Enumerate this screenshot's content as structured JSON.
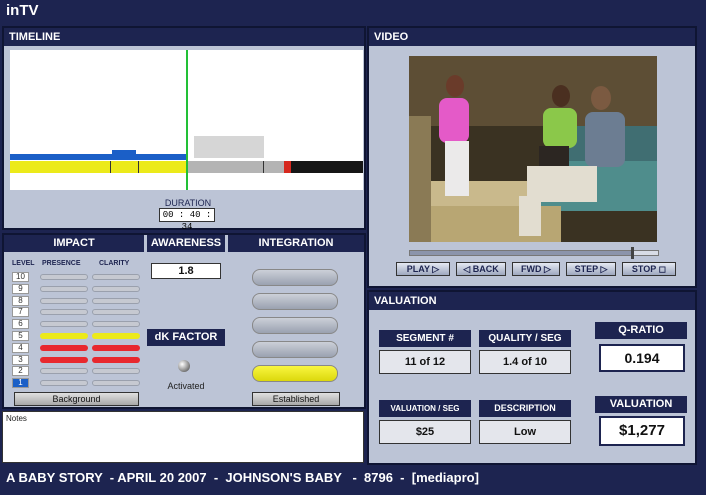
{
  "app": {
    "title": "inTV"
  },
  "timeline": {
    "title": "TIMELINE",
    "duration_label": "DURATION",
    "duration_value": "00 : 40 : 34"
  },
  "video": {
    "title": "VIDEO",
    "progress": 0.89,
    "buttons": {
      "play": "PLAY",
      "back": "BACK",
      "fwd": "FWD",
      "step": "STEP",
      "stop": "STOP"
    }
  },
  "impact": {
    "title": "IMPACT",
    "col_level": "LEVEL",
    "col_presence": "PRESENCE",
    "col_clarity": "CLARITY",
    "levels": [
      "10",
      "9",
      "8",
      "7",
      "6",
      "5",
      "4",
      "3",
      "2",
      "1"
    ],
    "active_level": "1",
    "background_button": "Background",
    "colors": {
      "yellow": "#ecea1a",
      "red": "#e8282e"
    }
  },
  "awareness": {
    "title": "AWARENESS",
    "value": "1.8"
  },
  "dk_factor": {
    "title": "dK FACTOR",
    "status": "Activated"
  },
  "integration": {
    "title": "INTEGRATION",
    "button": "Established"
  },
  "notes": {
    "label": "Notes"
  },
  "valuation": {
    "title": "VALUATION",
    "segment_label": "SEGMENT #",
    "segment_value": "11 of 12",
    "quality_label": "QUALITY / SEG",
    "quality_value": "1.4 of 10",
    "q_ratio_label": "Q-RATIO",
    "q_ratio_value": "0.194",
    "val_seg_label": "VALUATION / SEG",
    "val_seg_value": "$25",
    "description_label": "DESCRIPTION",
    "description_value": "Low",
    "valuation_label": "VALUATION",
    "valuation_value": "$1,277"
  },
  "footer": {
    "text": "A BABY STORY  - APRIL 20 2007  -  JOHNSON'S BABY   -  8796  -  [mediapro]"
  }
}
